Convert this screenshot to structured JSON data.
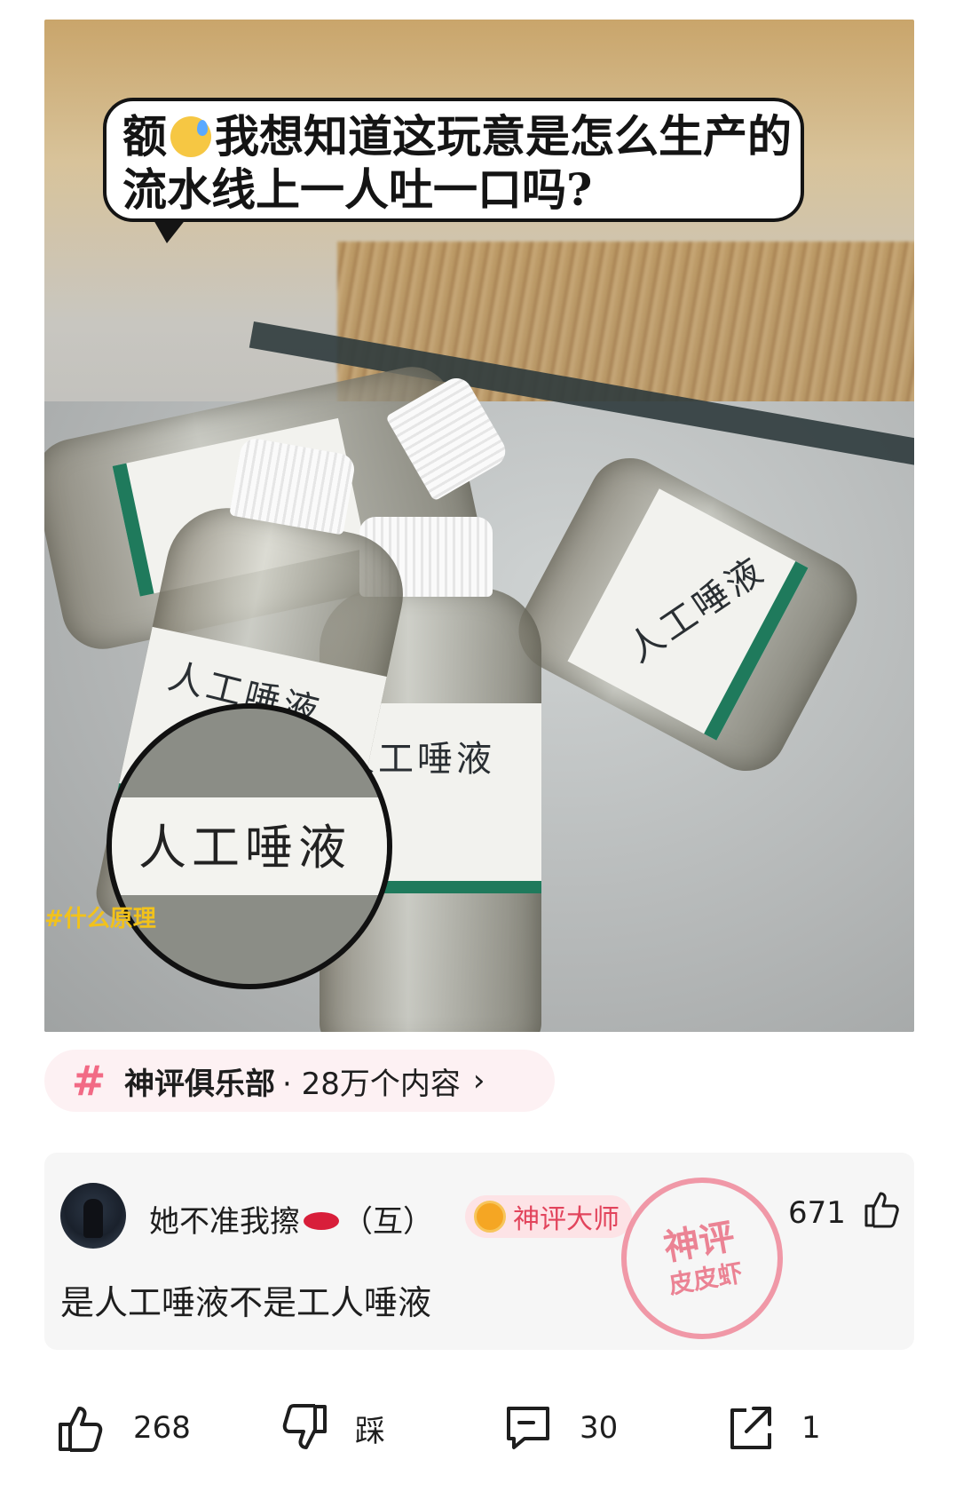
{
  "post_image": {
    "bubble_line1_a": "额",
    "bubble_line1_b": "我想知道这玩意是怎么生产的",
    "bubble_line2": "流水线上一人吐一口吗?",
    "bottle_label": "人工唾液",
    "overlay_tag": "#什么原理"
  },
  "topic": {
    "name": "神评俱乐部",
    "count": "· 28万个内容",
    "chevron": "›"
  },
  "comment": {
    "username_a": "她不准我擦",
    "username_b": "（互）",
    "badge": "神评大师",
    "likes": "671",
    "text": "是人工唾液不是工人唾液",
    "stamp_top": "神评",
    "stamp_bottom": "皮皮虾"
  },
  "actions": {
    "like_count": "268",
    "dislike_label": "踩",
    "comment_count": "30",
    "share_count": "1"
  }
}
